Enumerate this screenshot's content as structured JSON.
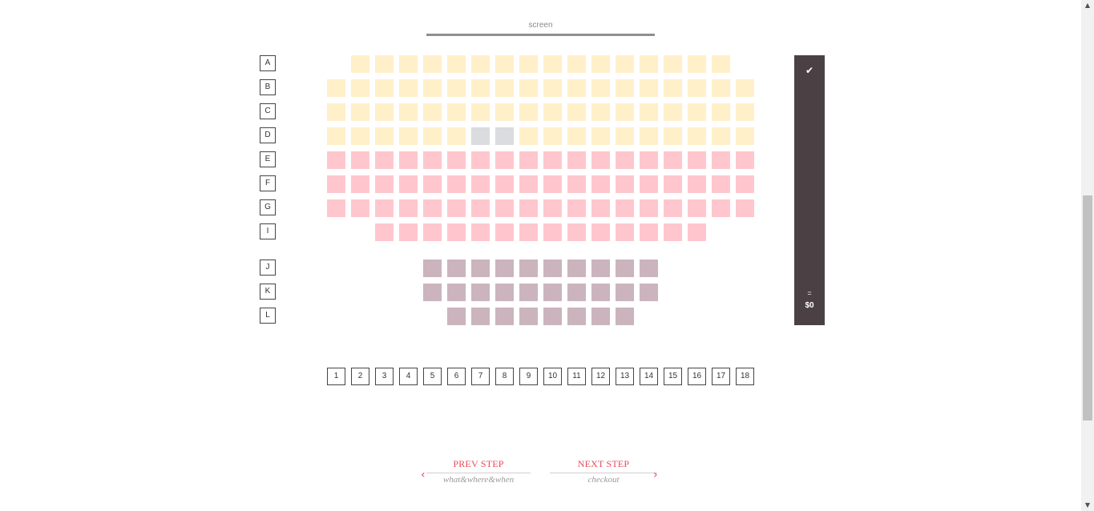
{
  "screen": {
    "label": "screen"
  },
  "rows": [
    {
      "label": "A",
      "tier": 1,
      "seats": [
        2,
        3,
        4,
        5,
        6,
        7,
        8,
        9,
        10,
        11,
        12,
        13,
        14,
        15,
        16,
        17
      ],
      "taken": []
    },
    {
      "label": "B",
      "tier": 1,
      "seats": [
        1,
        2,
        3,
        4,
        5,
        6,
        7,
        8,
        9,
        10,
        11,
        12,
        13,
        14,
        15,
        16,
        17,
        18
      ],
      "taken": []
    },
    {
      "label": "C",
      "tier": 1,
      "seats": [
        1,
        2,
        3,
        4,
        5,
        6,
        7,
        8,
        9,
        10,
        11,
        12,
        13,
        14,
        15,
        16,
        17,
        18
      ],
      "taken": []
    },
    {
      "label": "D",
      "tier": 1,
      "seats": [
        1,
        2,
        3,
        4,
        5,
        6,
        7,
        8,
        9,
        10,
        11,
        12,
        13,
        14,
        15,
        16,
        17,
        18
      ],
      "taken": [
        7,
        8
      ]
    },
    {
      "label": "E",
      "tier": 2,
      "seats": [
        1,
        2,
        3,
        4,
        5,
        6,
        7,
        8,
        9,
        10,
        11,
        12,
        13,
        14,
        15,
        16,
        17,
        18
      ],
      "taken": []
    },
    {
      "label": "F",
      "tier": 2,
      "seats": [
        1,
        2,
        3,
        4,
        5,
        6,
        7,
        8,
        9,
        10,
        11,
        12,
        13,
        14,
        15,
        16,
        17,
        18
      ],
      "taken": []
    },
    {
      "label": "G",
      "tier": 2,
      "seats": [
        1,
        2,
        3,
        4,
        5,
        6,
        7,
        8,
        9,
        10,
        11,
        12,
        13,
        14,
        15,
        16,
        17,
        18
      ],
      "taken": []
    },
    {
      "label": "I",
      "tier": 2,
      "seats": [
        3,
        4,
        5,
        6,
        7,
        8,
        9,
        10,
        11,
        12,
        13,
        14,
        15,
        16
      ],
      "taken": []
    },
    {
      "label": "J",
      "tier": 3,
      "seats": [
        5,
        6,
        7,
        8,
        9,
        10,
        11,
        12,
        13,
        14
      ],
      "taken": []
    },
    {
      "label": "K",
      "tier": 3,
      "seats": [
        5,
        6,
        7,
        8,
        9,
        10,
        11,
        12,
        13,
        14
      ],
      "taken": []
    },
    {
      "label": "L",
      "tier": 3,
      "seats": [
        6,
        7,
        8,
        9,
        10,
        11,
        12,
        13
      ],
      "taken": []
    }
  ],
  "columns": [
    "1",
    "2",
    "3",
    "4",
    "5",
    "6",
    "7",
    "8",
    "9",
    "10",
    "11",
    "12",
    "13",
    "14",
    "15",
    "16",
    "17",
    "18"
  ],
  "summary": {
    "check_icon": "check-icon",
    "equals": "=",
    "total": "$0"
  },
  "nav": {
    "prev": {
      "title": "PREV STEP",
      "subtitle": "what&where&when"
    },
    "next": {
      "title": "NEXT STEP",
      "subtitle": "checkout"
    }
  },
  "colors": {
    "tier1": "#fff0c9",
    "tier2": "#ffc7cd",
    "tier3": "#cbb4bd",
    "taken": "#dadcde",
    "panel": "#4b4145",
    "accent": "#e84a5a"
  }
}
